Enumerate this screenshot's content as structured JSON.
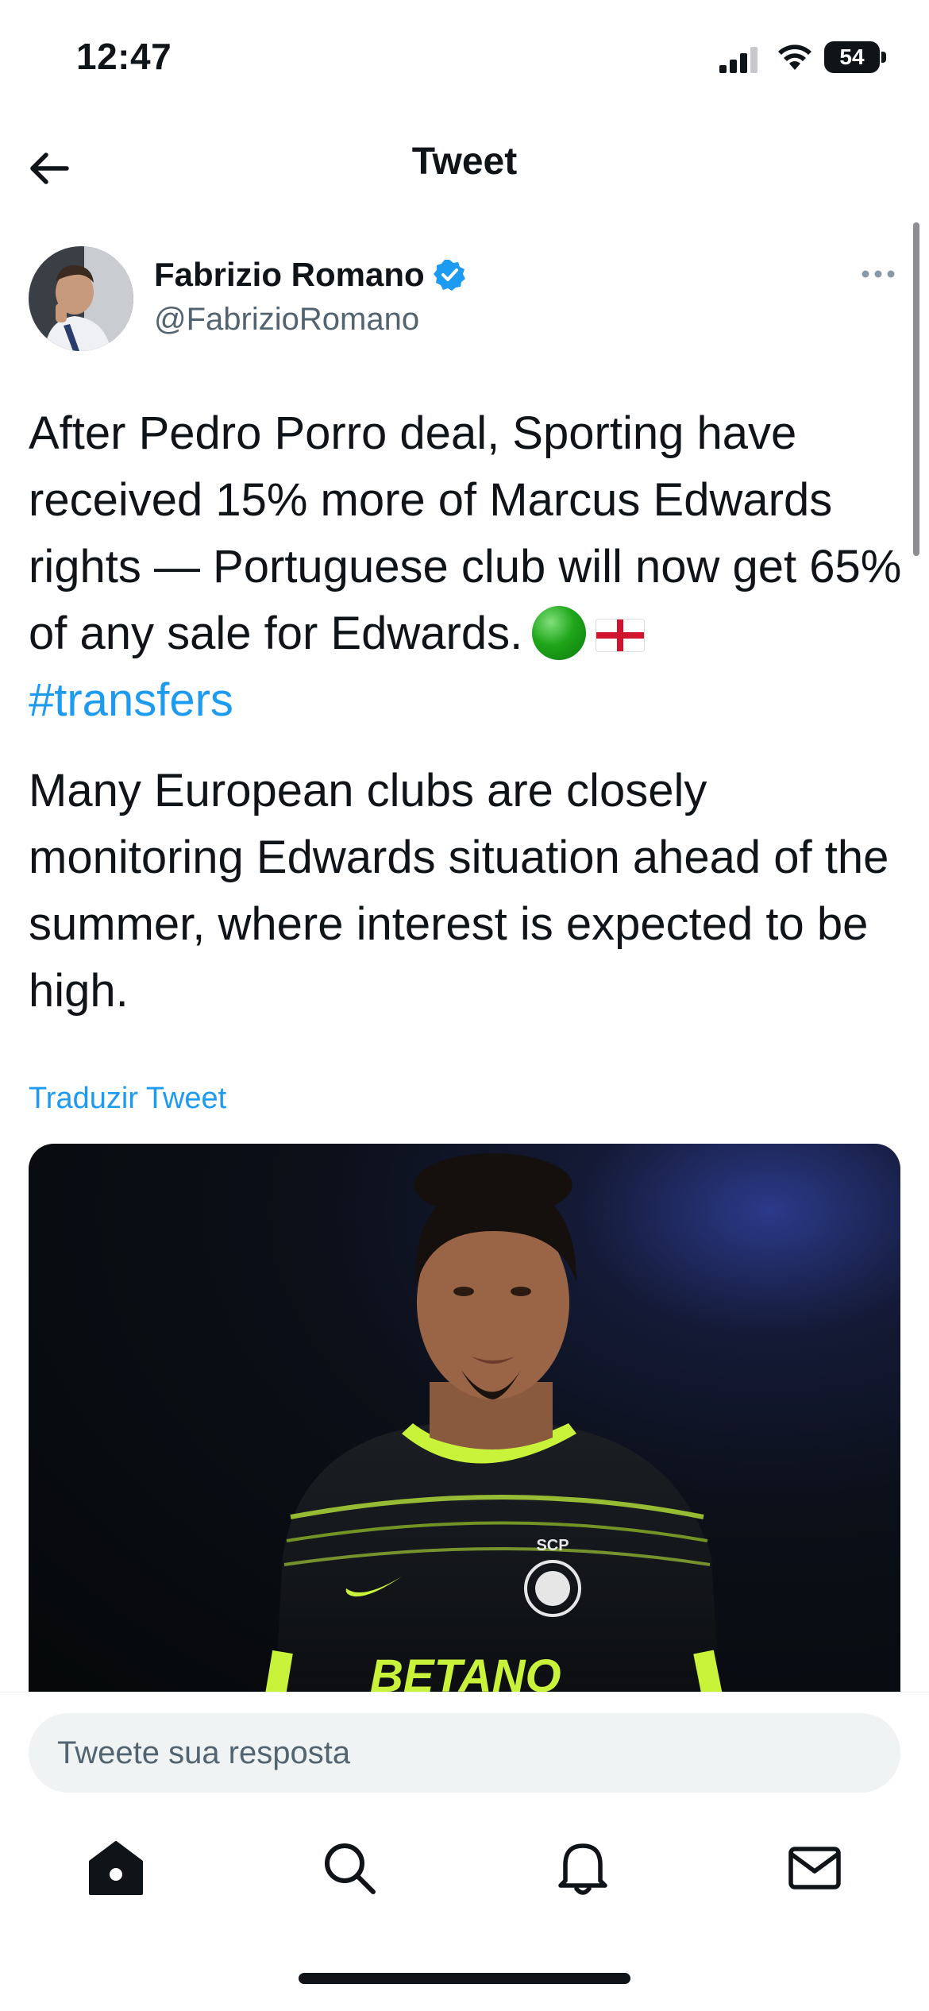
{
  "status_bar": {
    "time": "12:47",
    "battery": "54"
  },
  "header": {
    "title": "Tweet",
    "back_icon": "arrow-left-icon"
  },
  "tweet": {
    "author": {
      "name": "Fabrizio Romano",
      "handle": "@FabrizioRomano",
      "verified": true
    },
    "paragraph1": "After Pedro Porro deal, Sporting have received 15% more of Marcus Edwards rights — Portuguese club will now get 65% of any sale for Edwards.",
    "emojis": [
      "green-circle-emoji",
      "england-flag-emoji"
    ],
    "hashtag": "#transfers",
    "paragraph2": "Many European clubs are closely monitoring Edwards situation ahead of the summer, where interest is expected to be high.",
    "translate_label": "Traduzir Tweet",
    "media": {
      "jersey_sponsor": "BETANO",
      "crest_text": "SCP"
    }
  },
  "reply": {
    "placeholder": "Tweete sua resposta"
  },
  "tab_bar": {
    "items": [
      "home-icon",
      "search-icon",
      "notifications-icon",
      "messages-icon"
    ]
  },
  "colors": {
    "accent": "#1d9bf0",
    "text": "#0f1419",
    "secondary": "#536471"
  }
}
